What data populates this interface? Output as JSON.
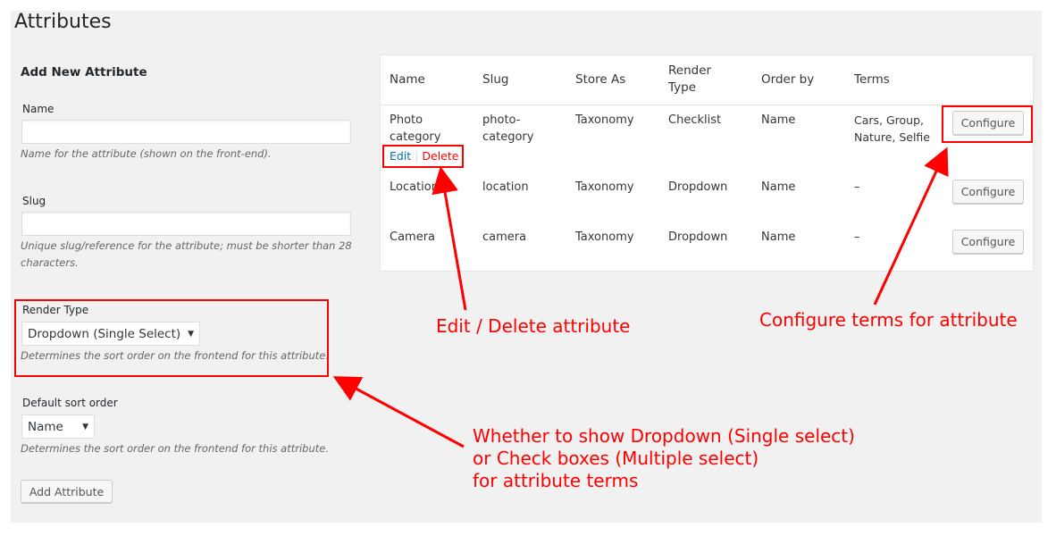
{
  "page_title": "Attributes",
  "form": {
    "heading": "Add New Attribute",
    "name_label": "Name",
    "name_value": "",
    "name_desc": "Name for the attribute (shown on the front-end).",
    "slug_label": "Slug",
    "slug_value": "",
    "slug_desc_1": "Unique slug/reference for the attribute; must be shorter than 28",
    "slug_desc_2": "characters.",
    "render_label": "Render Type",
    "render_value": "Dropdown (Single Select)",
    "render_desc": "Determines the sort order on the frontend for this attribute.",
    "sort_label": "Default sort order",
    "sort_value": "Name",
    "sort_desc": "Determines the sort order on the frontend for this attribute.",
    "submit": "Add Attribute"
  },
  "table": {
    "headers": [
      "Name",
      "Slug",
      "Store As",
      "Render",
      "Type",
      "Order by",
      "Terms"
    ],
    "rows": [
      {
        "name1": "Photo",
        "name2": "category",
        "slug1": "photo-",
        "slug2": "category",
        "store": "Taxonomy",
        "render": "Checklist",
        "order": "Name",
        "terms1": "Cars, Group,",
        "terms2": "Nature, Selfie",
        "edit": "Edit",
        "delete": "Delete",
        "configure": "Configure"
      },
      {
        "name1": "Location",
        "slug1": "location",
        "store": "Taxonomy",
        "render": "Dropdown",
        "order": "Name",
        "terms1": "–",
        "configure": "Configure"
      },
      {
        "name1": "Camera",
        "slug1": "camera",
        "store": "Taxonomy",
        "render": "Dropdown",
        "order": "Name",
        "terms1": "–",
        "configure": "Configure"
      }
    ]
  },
  "annotations": {
    "edit_delete": "Edit / Delete attribute",
    "configure": "Configure terms for attribute",
    "render_1": "Whether to show Dropdown (Single select)",
    "render_2": "or Check boxes (Multiple select)",
    "render_3": "for attribute terms"
  },
  "colors": {
    "annotation": "#ff0000",
    "link": "#0073aa",
    "delete": "#ff0000",
    "panel": "#f1f1f1"
  }
}
